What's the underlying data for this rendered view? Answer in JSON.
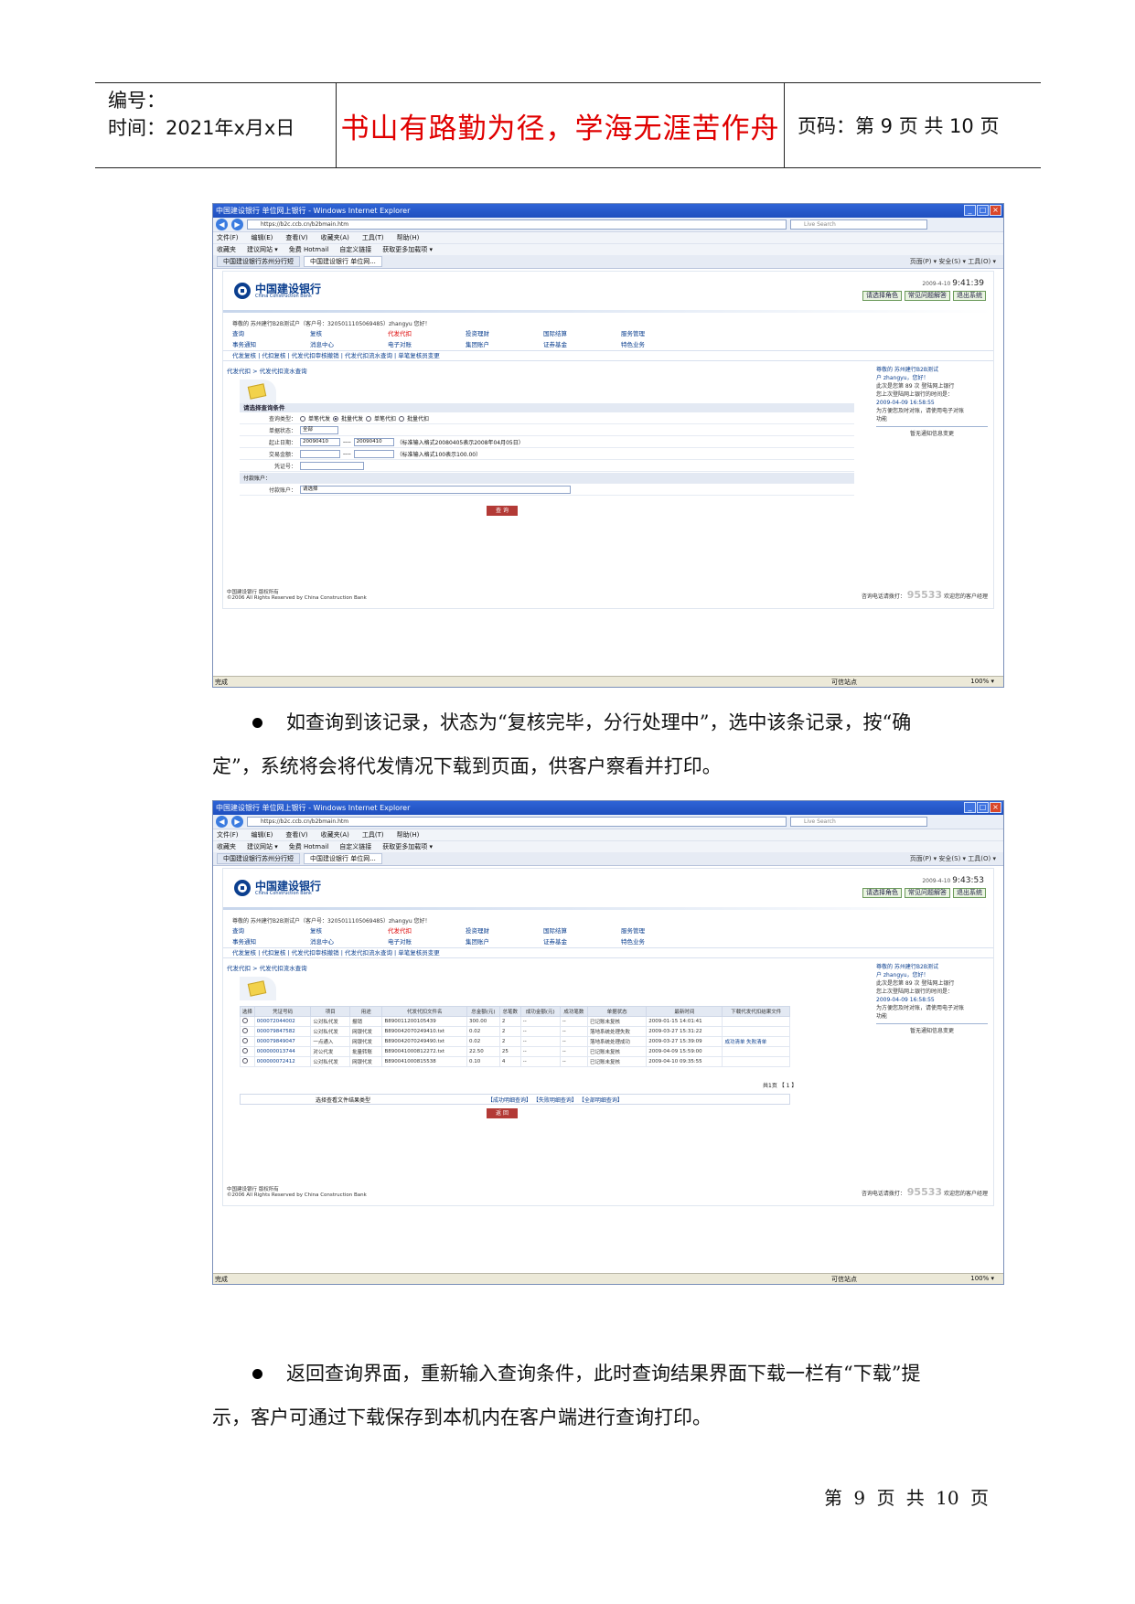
{
  "header": {
    "number_label": "编号：",
    "time_label": "时间：2021年x月x日",
    "motto": "书山有路勤为径，学海无涯苦作舟",
    "page_label": "页码：第 9 页  共 10 页"
  },
  "browser": {
    "title": "中国建设银行 单位网上银行 - Windows Internet Explorer",
    "url": "https://b2c.ccb.cn/b2bmain.htm",
    "search_placeholder": "Live Search",
    "menus": [
      "文件(F)",
      "编辑(E)",
      "查看(V)",
      "收藏夹(A)",
      "工具(T)",
      "帮助(H)"
    ],
    "favorites": [
      "收藏夹",
      "建议网站 ▾",
      "免费 Hotmail",
      "自定义链接",
      "获取更多加载项 ▾"
    ],
    "tabs": [
      "中国建设银行苏州分行短",
      "中国建设银行 单位网..."
    ],
    "tools": "页面(P) ▾  安全(S) ▾  工具(O) ▾",
    "status_left": "完成",
    "status_zone": "可信站点",
    "status_zoom": "100% ▾"
  },
  "bank": {
    "logo_cn": "中国建设银行",
    "logo_en": "China Construction Bank",
    "time1": "9:41:39",
    "time2": "9:43:53",
    "date": "2009-4-10",
    "top_buttons": [
      "请选择角色",
      "常见问题解答",
      "退出系统"
    ],
    "welcome": "尊敬的 苏州建行B2B测试户（客户号：3205011105069485）zhangyu 您好！",
    "nav": [
      "查询",
      "复核",
      "代发代扣",
      "投资理财",
      "国际结算",
      "服务管理",
      "事务通知",
      "消息中心",
      "电子对账",
      "集团账户",
      "证券基金",
      "特色业务"
    ],
    "subnav": "代发复核 | 代扣复核 | 代发代扣审核撤销 | 代发代扣流水查询 | 单笔复核员变更",
    "crumb": "代发代扣 > 代发代扣流水查询",
    "right_panel": {
      "greet": "尊敬的 苏州建行B2B测试",
      "user": "户 zhangyu，您好！",
      "line1": "此次是您第 89 次 登陆网上银行",
      "line2": "您上次登陆网上银行的时间是：",
      "time": "2009-04-09 16:58:55",
      "line3": "为方便您及时对账，请使用电子对账",
      "line4": "功能",
      "notice": "暂无通知信息变更"
    },
    "footer_line1": "中国建设银行 版权所有",
    "footer_line2": "©2006 All Rights Reserved by China Construction Bank",
    "hotline_label": "咨询电话请拨打：",
    "hotline": "95533",
    "hotline_suffix": "欢迎您的客户经理"
  },
  "form": {
    "title": "请选择查询条件",
    "type_label": "查询类型：",
    "types": [
      "单笔代发",
      "批量代发",
      "单笔代扣",
      "批量代扣"
    ],
    "status_label": "单据状态：",
    "status_value": "全部",
    "date_label": "起止日期：",
    "date_from": "20090410",
    "date_to": "20090410",
    "date_hint": "（标准输入格式20080405表示2008年04月05日）",
    "amount_label": "交易金额：",
    "amount_hint": "（标准输入格式100表示100.00）",
    "voucher_label": "凭证号：",
    "acct_section": "付款账户：",
    "acct_label": "付款账户：",
    "acct_value": "请选择",
    "submit": "查 询"
  },
  "results": {
    "headers": [
      "选择",
      "凭证号码",
      "项目",
      "用途",
      "代发代扣文件名",
      "总金额(元)",
      "总笔数",
      "成功金额(元)",
      "成功笔数",
      "单据状态",
      "最新时间",
      "下载代发代扣结果文件"
    ],
    "rows": [
      [
        "",
        "000072044002",
        "公对私代发",
        "报销",
        "B890011200105439",
        "300.00",
        "2",
        "--",
        "--",
        "已记账未复核",
        "2009-01-15 14:01:41",
        ""
      ],
      [
        "",
        "000079847582",
        "公对私代发",
        "网银代发",
        "B890042070249410.txt",
        "0.02",
        "2",
        "--",
        "--",
        "落地系统处理失败",
        "2009-03-27 15:31:22",
        ""
      ],
      [
        "",
        "000079849047",
        "一点通入",
        "网银代发",
        "B890042070249490.txt",
        "0.02",
        "2",
        "--",
        "--",
        "落地系统处理成功",
        "2009-03-27 15:39:09",
        "成功清单  失败清单"
      ],
      [
        "",
        "000000013744",
        "对公代发",
        "批量转账",
        "B890041000812272.txt",
        "22.50",
        "25",
        "--",
        "--",
        "已记账未复核",
        "2009-04-09 15:59:00",
        ""
      ],
      [
        "",
        "000000072412",
        "公对私代发",
        "网银代发",
        "B890041000815538",
        "0.10",
        "4",
        "--",
        "--",
        "已记账未复核",
        "2009-04-10 09:35:55",
        ""
      ]
    ],
    "pager": "共1页  【 1 】",
    "dl_label": "选择查看文件结果类型",
    "dl_links": "【成功明细查询】 【失败明细查询】 【全部明细查询】",
    "back": "返 回"
  },
  "body_text": {
    "para1_line1": "如查询到该记录，状态为“复核完毕，分行处理中”，选中该条记录，按“确",
    "para1_line2": "定”，系统将会将代发情况下载到页面，供客户察看并打印。",
    "para2_line1": "返回查询界面，重新输入查询条件，此时查询结果界面下载一栏有“下载”提",
    "para2_line2": "示，客户可通过下载保存到本机内在客户端进行查询打印。"
  },
  "page_footer": "第 9 页 共 10 页"
}
